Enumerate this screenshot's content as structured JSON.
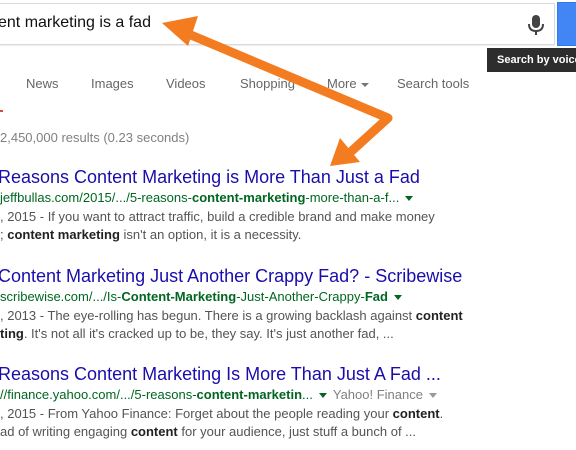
{
  "search": {
    "query": "ent marketing is a fad",
    "tooltip": "Search by voice"
  },
  "tabs": [
    "News",
    "Images",
    "Videos",
    "Shopping",
    "More",
    "Search tools"
  ],
  "stats": "2,450,000 results (0.23 seconds)",
  "results": [
    {
      "title": "Reasons Content Marketing is More Than Just a Fad",
      "url": {
        "pre": "jeffbullas.com/2015/.../5-reasons-",
        "b1": "content-marketing",
        "post": "-more-than-a-f..."
      },
      "snippet1": ", 2015 - If you want to attract traffic, build a credible brand and make money",
      "snippet2": {
        "pre": "; ",
        "b1": "content marketing",
        "post": " isn't an option, it is a necessity."
      }
    },
    {
      "title": "Content Marketing Just Another Crappy Fad? - Scribewise",
      "url": {
        "pre": "scribewise.com/.../Is-",
        "b1": "Content-Marketing",
        "mid": "-Just-Another-Crappy-",
        "b2": "Fad"
      },
      "snippet1": {
        "pre": ", 2013 - The eye-rolling has begun. There is a growing backlash against ",
        "b1": "content"
      },
      "snippet2": {
        "pre": "",
        "b1": "ting",
        "post": ". It's not all it's cracked up to be, they say. It's just another fad, ..."
      }
    },
    {
      "title": "Reasons Content Marketing Is More Than Just A Fad ...",
      "url": {
        "pre": "//finance.yahoo.com/.../5-reasons-",
        "b1": "content-marketin",
        "post": "...",
        "source": "Yahoo! Finance"
      },
      "snippet1": {
        "pre": ", 2015 - From Yahoo Finance: Forget about the people reading your ",
        "b1": "content",
        "post": "."
      },
      "snippet2": {
        "pre": "ad of writing engaging ",
        "b1": "content",
        "post": " for your audience, just stuff a bunch of ..."
      }
    }
  ]
}
